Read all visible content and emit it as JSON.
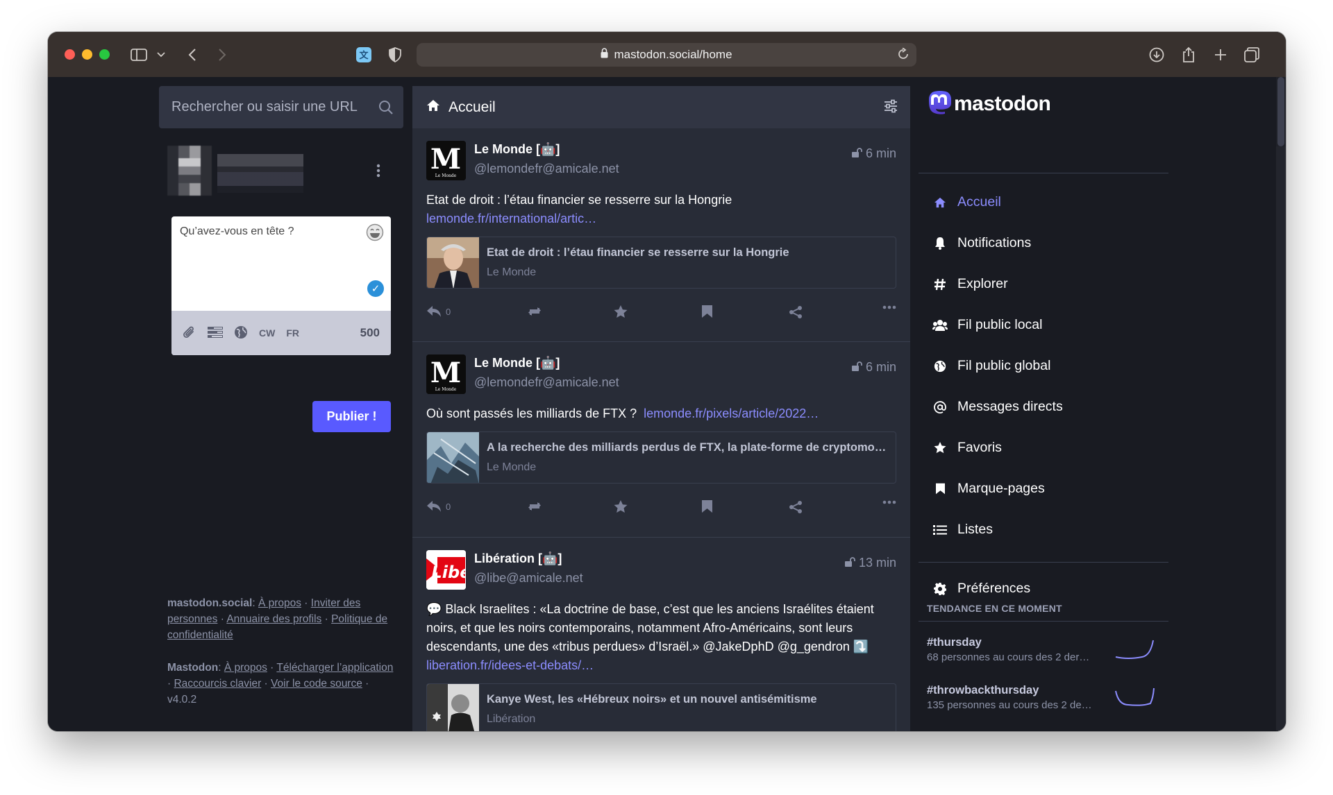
{
  "browser": {
    "url": "mastodon.social/home"
  },
  "left": {
    "search_placeholder": "Rechercher ou saisir une URL",
    "compose": {
      "placeholder": "Qu’avez-vous en tête ?",
      "cw_label": "CW",
      "lang_label": "FR",
      "char_count": "500"
    },
    "publish_label": "Publier !",
    "footer": {
      "site_name": "mastodon.social",
      "about_label": "À propos",
      "invite_label": "Inviter des personnes",
      "directory_label": "Annuaire des profils",
      "privacy_label": "Politique de confidentialité",
      "mastodon_label": "Mastodon",
      "about2_label": "À propos",
      "download_label": "Télécharger l’application",
      "shortcuts_label": "Raccourcis clavier",
      "source_label": "Voir le code source",
      "version": "v4.0.2"
    }
  },
  "feed": {
    "title": "Accueil",
    "posts": [
      {
        "name": "Le Monde [🤖]",
        "handle": "@lemondefr@amicale.net",
        "time": "6 min",
        "text": "Etat de droit : l’étau financier se resserre sur la Hongrie",
        "link": "lemonde.fr/international/artic…",
        "card_title": "Etat de droit : l’étau financier se resserre sur la Hongrie",
        "card_source": "Le Monde",
        "replies": "0"
      },
      {
        "name": "Le Monde [🤖]",
        "handle": "@lemondefr@amicale.net",
        "time": "6 min",
        "text": "Où sont passés les milliards de FTX ?",
        "link": "lemonde.fr/pixels/article/2022…",
        "card_title": "A la recherche des milliards perdus de FTX, la plate-forme de cryptomonn…",
        "card_source": "Le Monde",
        "replies": "0"
      },
      {
        "name": "Libération [🤖]",
        "handle": "@libe@amicale.net",
        "time": "13 min",
        "text": "💬 Black Israelites : «La doctrine de base, c’est que les anciens Israélites étaient noirs, et que les noirs contemporains, notamment Afro-Américains, sont leurs descendants, une des «tribus perdues» d’Israël.» @JakeDphD @g_gendron ⤵️",
        "link": "liberation.fr/idees-et-debats/…",
        "card_title": "Kanye West, les «Hébreux noirs» et un nouvel antisémitisme",
        "card_source": "Libération"
      }
    ]
  },
  "nav": {
    "brand": "mastodon",
    "items": [
      {
        "label": "Accueil",
        "icon": "home-icon"
      },
      {
        "label": "Notifications",
        "icon": "bell-icon"
      },
      {
        "label": "Explorer",
        "icon": "hashtag-icon"
      },
      {
        "label": "Fil public local",
        "icon": "users-icon"
      },
      {
        "label": "Fil public global",
        "icon": "globe-icon"
      },
      {
        "label": "Messages directs",
        "icon": "at-icon"
      },
      {
        "label": "Favoris",
        "icon": "star-icon"
      },
      {
        "label": "Marque-pages",
        "icon": "bookmark-icon"
      },
      {
        "label": "Listes",
        "icon": "list-icon"
      }
    ],
    "preferences": "Préférences"
  },
  "trending": {
    "title": "TENDANCE EN CE MOMENT",
    "items": [
      {
        "tag": "#thursday",
        "desc": "68 personnes au cours des 2 der…"
      },
      {
        "tag": "#throwbackthursday",
        "desc": "135 personnes au cours des 2 de…"
      }
    ]
  },
  "colors": {
    "accent": "#8c8dff",
    "publish": "#595aff",
    "background": "#191b22",
    "column": "#282c37"
  }
}
